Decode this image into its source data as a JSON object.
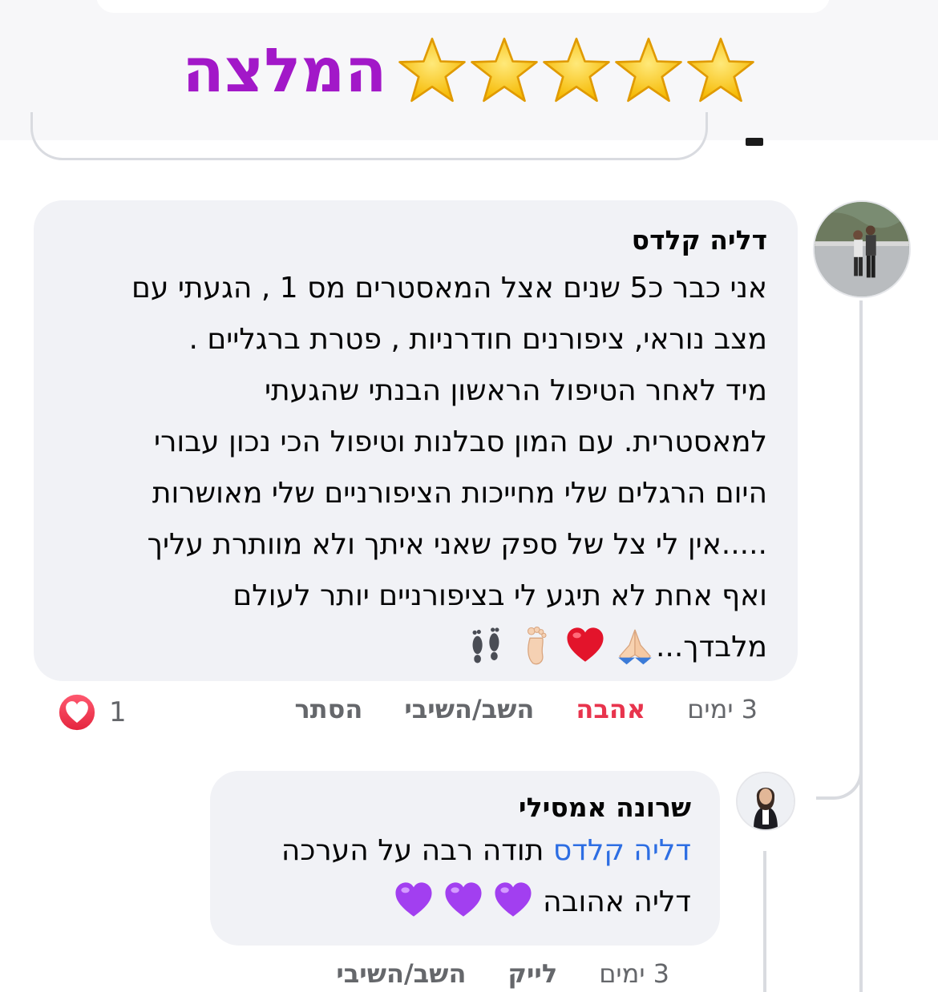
{
  "banner": {
    "title": "המלצה",
    "stars": 5,
    "title_color": "#a218c8"
  },
  "comments": [
    {
      "author": "דליה קלדס",
      "text": "אני כבר כ5 שנים אצל המאסטרים מס 1 , הגעתי עם\nמצב נוראי, ציפורנים חודרניות , פטרת ברגליים .\nמיד לאחר הטיפול הראשון הבנתי שהגעתי\nלמאסטרית. עם המון סבלנות וטיפול הכי נכון עבורי\nהיום הרגלים שלי מחייכות הציפורניים שלי מאושרות\n.....אין לי צל של ספק שאני איתך  ולא מוותרת עליך\nואף אחת לא תיגע לי בציפורניים יותר לעולם\nמלבדך...",
      "emojis": [
        "folded-hands-emoji",
        "red-heart-emoji",
        "foot-emoji",
        "footprints-emoji"
      ],
      "time": "3 ימים",
      "reaction_label": "אהבה",
      "reply_label": "השב/השיבי",
      "hide_label": "הסתר",
      "reaction_count": "1"
    },
    {
      "author": "שרונה אמסילי",
      "mention": "דליה קלדס",
      "text_line1": " תודה רבה על הערכה",
      "text_line2": "דליה אהובה",
      "emojis": [
        "purple-heart-emoji",
        "purple-heart-emoji",
        "purple-heart-emoji"
      ],
      "time": "3 ימים",
      "like_label": "לייק",
      "reply_label": "השב/השיבי"
    }
  ],
  "colors": {
    "love": "#e8344d",
    "mention": "#2d6ee3",
    "bubble": "#f1f2f6",
    "meta": "#65676b"
  }
}
